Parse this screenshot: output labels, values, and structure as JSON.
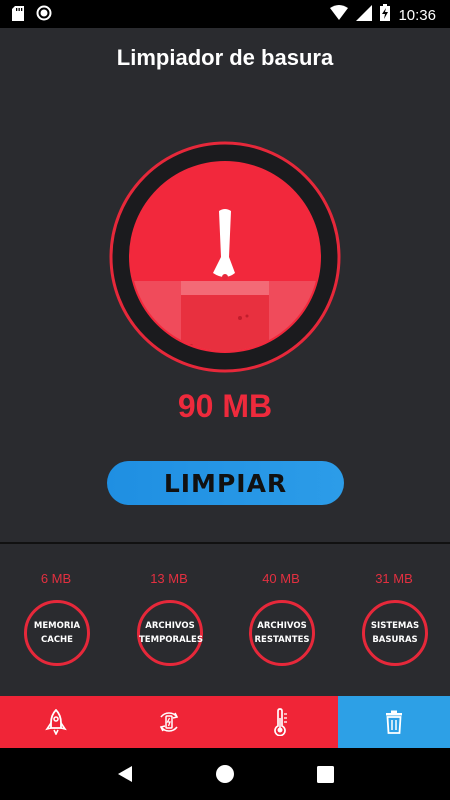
{
  "status_bar": {
    "time": "10:36"
  },
  "header": {
    "title": "Limpiador de basura"
  },
  "main": {
    "junk_size": "90 MB",
    "clean_button": "LIMPIAR"
  },
  "categories": [
    {
      "size": "6 MB",
      "label_1": "MEMORIA",
      "label_2": "CACHE"
    },
    {
      "size": "13 MB",
      "label_1": "ARCHIVOS",
      "label_2": "TEMPORALES"
    },
    {
      "size": "40 MB",
      "label_1": "ARCHIVOS",
      "label_2": "RESTANTES"
    },
    {
      "size": "31 MB",
      "label_1": "SISTEMAS",
      "label_2": "BASURAS"
    }
  ],
  "bottom_nav": [
    {
      "icon": "rocket-icon"
    },
    {
      "icon": "battery-refresh-icon"
    },
    {
      "icon": "thermometer-icon"
    },
    {
      "icon": "trash-icon",
      "active": true
    }
  ],
  "colors": {
    "accent_red": "#f02537",
    "accent_blue": "#2da0e6",
    "background": "#2a2b2f"
  }
}
